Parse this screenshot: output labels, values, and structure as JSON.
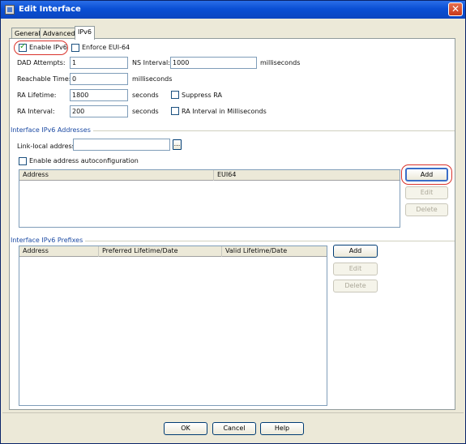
{
  "window": {
    "title": "Edit Interface"
  },
  "tabs": [
    {
      "label": "General"
    },
    {
      "label": "Advanced"
    },
    {
      "label": "IPv6"
    }
  ],
  "ipv6": {
    "enable_ipv6": {
      "label": "Enable IPv6",
      "checked": true
    },
    "enforce_eui64": {
      "label": "Enforce EUI-64",
      "checked": false
    },
    "dad_attempts": {
      "label": "DAD Attempts:",
      "value": "1"
    },
    "ns_interval": {
      "label": "NS Interval:",
      "value": "1000",
      "unit": "milliseconds"
    },
    "reachable_time": {
      "label": "Reachable Time:",
      "value": "0",
      "unit": "milliseconds"
    },
    "ra_lifetime": {
      "label": "RA Lifetime:",
      "value": "1800",
      "unit": "seconds"
    },
    "suppress_ra": {
      "label": "Suppress RA",
      "checked": false
    },
    "ra_interval": {
      "label": "RA Interval:",
      "value": "200",
      "unit": "seconds"
    },
    "ra_interval_ms": {
      "label": "RA Interval in Milliseconds",
      "checked": false
    }
  },
  "addresses": {
    "group_title": "Interface IPv6 Addresses",
    "link_local_label": "Link-local address:",
    "link_local_value": "",
    "browse_label": "...",
    "autoconfig": {
      "label": "Enable address autoconfiguration",
      "checked": false
    },
    "columns": [
      "Address",
      "EUI64"
    ],
    "rows": [],
    "buttons": {
      "add": "Add",
      "edit": "Edit",
      "delete": "Delete"
    }
  },
  "prefixes": {
    "group_title": "Interface IPv6 Prefixes",
    "columns": [
      "Address",
      "Preferred Lifetime/Date",
      "Valid Lifetime/Date"
    ],
    "rows": [],
    "buttons": {
      "add": "Add",
      "edit": "Edit",
      "delete": "Delete"
    }
  },
  "footer": {
    "ok": "OK",
    "cancel": "Cancel",
    "help": "Help"
  },
  "colors": {
    "annotation_ring": "#d9322b",
    "titlebar": "#0a4fd4"
  }
}
